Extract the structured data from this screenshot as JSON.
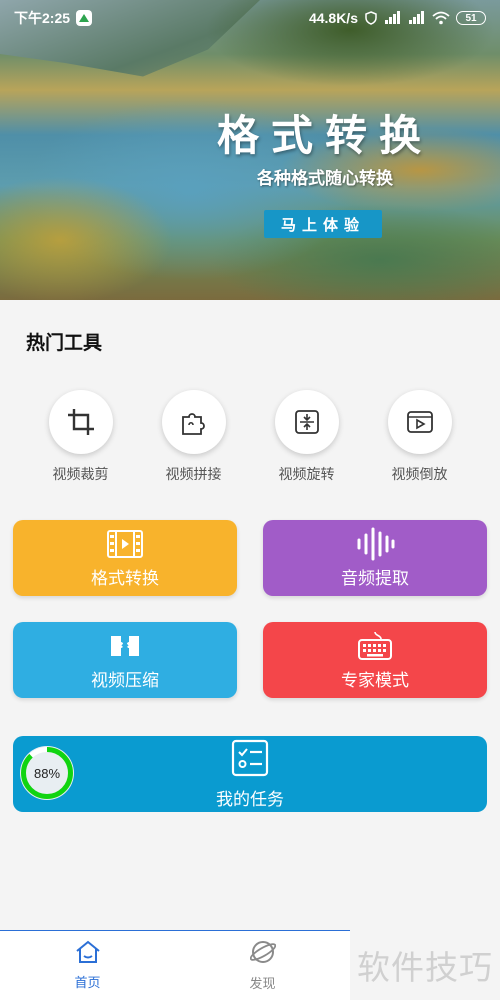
{
  "status_bar": {
    "time": "下午2:25",
    "net_speed": "44.8K/s",
    "battery": "51"
  },
  "banner": {
    "title": "格式转换",
    "subtitle": "各种格式随心转换",
    "cta_label": "马上体验"
  },
  "hot_tools": {
    "title": "热门工具",
    "items": [
      {
        "label": "视频裁剪",
        "icon": "crop-icon"
      },
      {
        "label": "视频拼接",
        "icon": "puzzle-icon"
      },
      {
        "label": "视频旋转",
        "icon": "rotate-icon"
      },
      {
        "label": "视频倒放",
        "icon": "reverse-play-icon"
      }
    ]
  },
  "features": {
    "format_convert": {
      "label": "格式转换",
      "color": "#f8b32c",
      "icon": "film-icon"
    },
    "audio_extract": {
      "label": "音频提取",
      "color": "#a15cc8",
      "icon": "waveform-icon"
    },
    "video_compress": {
      "label": "视频压缩",
      "color": "#2faee2",
      "icon": "compress-icon"
    },
    "expert_mode": {
      "label": "专家模式",
      "color": "#f4464a",
      "icon": "keyboard-icon"
    }
  },
  "my_tasks": {
    "label": "我的任务",
    "progress_text": "88%",
    "progress": 0.88,
    "color": "#0a9bd0"
  },
  "bottom_nav": {
    "items": [
      {
        "label": "首页",
        "active": true,
        "icon": "home-icon"
      },
      {
        "label": "发现",
        "active": false,
        "icon": "discover-icon"
      }
    ],
    "active_color": "#2b6fd6"
  },
  "watermark": "软件技巧"
}
